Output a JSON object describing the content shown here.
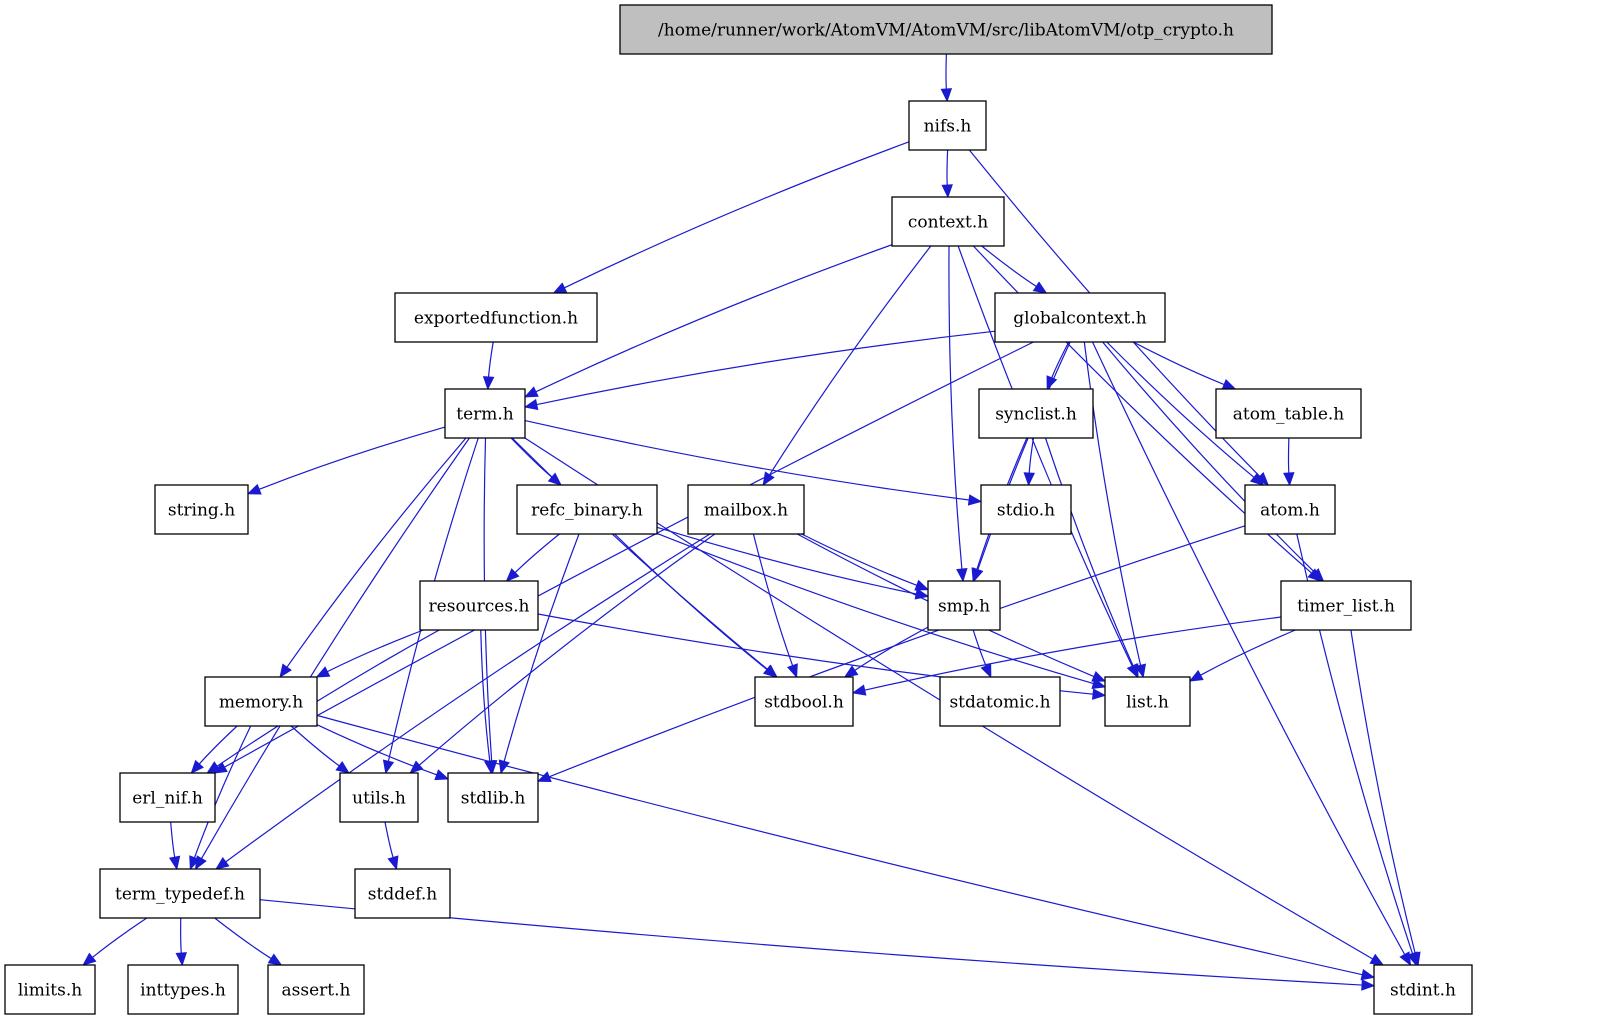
{
  "graph": {
    "type": "include-dependency-graph",
    "root": "/home/runner/work/AtomVM/AtomVM/src/libAtomVM/otp_crypto.h",
    "colors": {
      "edge": "#1a1ad0",
      "root_fill": "#bfbfbf",
      "node_fill": "#ffffff",
      "node_border": "#000000"
    },
    "nodes": [
      {
        "id": "otp_crypto",
        "label": "/home/runner/work/AtomVM/AtomVM/src/libAtomVM/otp_crypto.h",
        "root": true
      },
      {
        "id": "nifs",
        "label": "nifs.h"
      },
      {
        "id": "context",
        "label": "context.h"
      },
      {
        "id": "exportedfunction",
        "label": "exportedfunction.h"
      },
      {
        "id": "globalcontext",
        "label": "globalcontext.h"
      },
      {
        "id": "term",
        "label": "term.h"
      },
      {
        "id": "synclist",
        "label": "synclist.h"
      },
      {
        "id": "atom_table",
        "label": "atom_table.h"
      },
      {
        "id": "string",
        "label": "string.h"
      },
      {
        "id": "refc_binary",
        "label": "refc_binary.h"
      },
      {
        "id": "mailbox",
        "label": "mailbox.h"
      },
      {
        "id": "stdio",
        "label": "stdio.h"
      },
      {
        "id": "atom",
        "label": "atom.h"
      },
      {
        "id": "resources",
        "label": "resources.h"
      },
      {
        "id": "smp",
        "label": "smp.h"
      },
      {
        "id": "timer_list",
        "label": "timer_list.h"
      },
      {
        "id": "memory",
        "label": "memory.h"
      },
      {
        "id": "stdbool",
        "label": "stdbool.h"
      },
      {
        "id": "stdatomic",
        "label": "stdatomic.h"
      },
      {
        "id": "list",
        "label": "list.h"
      },
      {
        "id": "erl_nif",
        "label": "erl_nif.h"
      },
      {
        "id": "utils",
        "label": "utils.h"
      },
      {
        "id": "stdlib",
        "label": "stdlib.h"
      },
      {
        "id": "term_typedef",
        "label": "term_typedef.h"
      },
      {
        "id": "stddef",
        "label": "stddef.h"
      },
      {
        "id": "limits",
        "label": "limits.h"
      },
      {
        "id": "inttypes",
        "label": "inttypes.h"
      },
      {
        "id": "assert",
        "label": "assert.h"
      },
      {
        "id": "stdint",
        "label": "stdint.h"
      }
    ],
    "edges": [
      [
        "otp_crypto",
        "nifs"
      ],
      [
        "nifs",
        "context"
      ],
      [
        "nifs",
        "exportedfunction"
      ],
      [
        "nifs",
        "atom"
      ],
      [
        "context",
        "globalcontext"
      ],
      [
        "context",
        "term"
      ],
      [
        "context",
        "mailbox"
      ],
      [
        "context",
        "smp"
      ],
      [
        "context",
        "timer_list"
      ],
      [
        "context",
        "list"
      ],
      [
        "exportedfunction",
        "term"
      ],
      [
        "globalcontext",
        "term"
      ],
      [
        "globalcontext",
        "erl_nif"
      ],
      [
        "globalcontext",
        "synclist"
      ],
      [
        "globalcontext",
        "atom_table"
      ],
      [
        "globalcontext",
        "atom"
      ],
      [
        "globalcontext",
        "smp"
      ],
      [
        "globalcontext",
        "list"
      ],
      [
        "globalcontext",
        "timer_list"
      ],
      [
        "globalcontext",
        "stdint"
      ],
      [
        "term",
        "string"
      ],
      [
        "term",
        "refc_binary"
      ],
      [
        "term",
        "stdio"
      ],
      [
        "term",
        "memory"
      ],
      [
        "term",
        "utils"
      ],
      [
        "term",
        "stdlib"
      ],
      [
        "term",
        "stdbool"
      ],
      [
        "term",
        "term_typedef"
      ],
      [
        "term",
        "stdint"
      ],
      [
        "synclist",
        "stdio"
      ],
      [
        "synclist",
        "smp"
      ],
      [
        "synclist",
        "list"
      ],
      [
        "atom_table",
        "atom"
      ],
      [
        "atom",
        "stdlib"
      ],
      [
        "atom",
        "stdint"
      ],
      [
        "refc_binary",
        "resources"
      ],
      [
        "refc_binary",
        "smp"
      ],
      [
        "refc_binary",
        "stdbool"
      ],
      [
        "refc_binary",
        "list"
      ],
      [
        "refc_binary",
        "stdlib"
      ],
      [
        "mailbox",
        "smp"
      ],
      [
        "mailbox",
        "stdbool"
      ],
      [
        "mailbox",
        "list"
      ],
      [
        "mailbox",
        "utils"
      ],
      [
        "mailbox",
        "term_typedef"
      ],
      [
        "resources",
        "memory"
      ],
      [
        "resources",
        "erl_nif"
      ],
      [
        "resources",
        "stdlib"
      ],
      [
        "resources",
        "list"
      ],
      [
        "smp",
        "stdbool"
      ],
      [
        "smp",
        "stdatomic"
      ],
      [
        "timer_list",
        "list"
      ],
      [
        "timer_list",
        "stdbool"
      ],
      [
        "timer_list",
        "stdint"
      ],
      [
        "memory",
        "erl_nif"
      ],
      [
        "memory",
        "utils"
      ],
      [
        "memory",
        "stdlib"
      ],
      [
        "memory",
        "term_typedef"
      ],
      [
        "memory",
        "stdint"
      ],
      [
        "erl_nif",
        "term_typedef"
      ],
      [
        "utils",
        "stddef"
      ],
      [
        "term_typedef",
        "limits"
      ],
      [
        "term_typedef",
        "inttypes"
      ],
      [
        "term_typedef",
        "assert"
      ],
      [
        "term_typedef",
        "stdint"
      ]
    ]
  }
}
